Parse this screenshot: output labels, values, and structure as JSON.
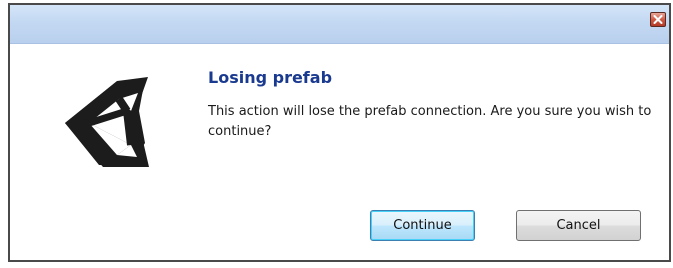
{
  "dialog": {
    "title": "",
    "heading": "Losing prefab",
    "message": "This action will lose the prefab connection. Are you sure you wish to continue?",
    "logo_icon": "unity-logo-icon",
    "close_icon": "close-icon"
  },
  "buttons": {
    "continue_label": "Continue",
    "cancel_label": "Cancel"
  },
  "colors": {
    "heading": "#1a3a8f",
    "titlebar": "#c3d8f2",
    "close_button": "#cf5a46",
    "default_button_border": "#3c7fb1"
  }
}
